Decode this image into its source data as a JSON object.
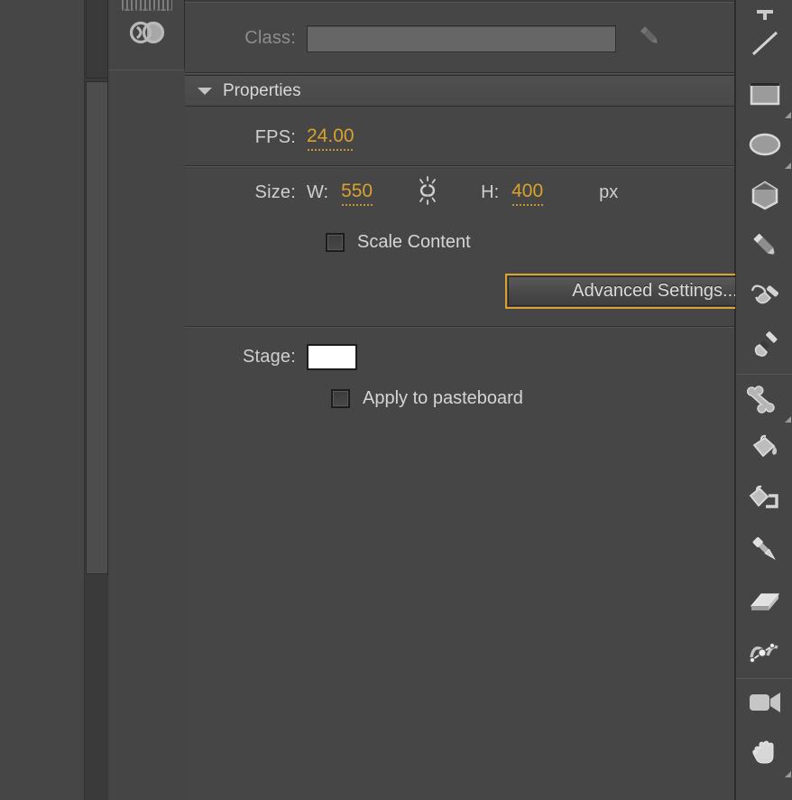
{
  "panel": {
    "class": {
      "label": "Class:",
      "value": "",
      "placeholder": "",
      "edit_icon": "pencil-icon"
    },
    "properties_section": {
      "title": "Properties",
      "disclosure": "triangle-down-icon",
      "expanded": true
    },
    "fps": {
      "label": "FPS:",
      "value": "24.00"
    },
    "size": {
      "label": "Size:",
      "w_label": "W:",
      "w_value": "550",
      "link_icon": "broken-link-icon",
      "link_state": "unlinked",
      "h_label": "H:",
      "h_value": "400",
      "unit": "px"
    },
    "scale_content": {
      "label": "Scale Content",
      "checked": false
    },
    "advanced_settings": {
      "label": "Advanced Settings...",
      "focused": true
    },
    "stage": {
      "label": "Stage:",
      "color": "#ffffff"
    },
    "apply_to_pasteboard": {
      "label": "Apply to pasteboard",
      "checked": false
    }
  },
  "dock": {
    "grip": "drag-grip-icon",
    "items": [
      {
        "icon": "creative-cloud-icon",
        "name": "creative-cloud-libraries"
      }
    ]
  },
  "tools": [
    {
      "name": "text-tool",
      "icon": "text-tool-icon",
      "clipped": true,
      "corner": false
    },
    {
      "name": "line-tool",
      "icon": "line-tool-icon",
      "clipped": false,
      "corner": false
    },
    {
      "name": "rectangle-tool",
      "icon": "rectangle-tool-icon",
      "clipped": false,
      "corner": true
    },
    {
      "name": "oval-tool",
      "icon": "oval-tool-icon",
      "clipped": false,
      "corner": true
    },
    {
      "name": "polystar-tool",
      "icon": "polystar-tool-icon",
      "clipped": false,
      "corner": false
    },
    {
      "name": "pencil-tool",
      "icon": "pencil-tool-icon",
      "clipped": false,
      "corner": false
    },
    {
      "name": "paint-brush-tool",
      "icon": "paint-brush-tool-icon",
      "clipped": false,
      "corner": false
    },
    {
      "name": "brush-tool",
      "icon": "brush-tool-icon",
      "clipped": false,
      "corner": false
    },
    {
      "name": "bone-tool",
      "icon": "bone-tool-icon",
      "clipped": false,
      "corner": true
    },
    {
      "name": "paint-bucket-tool",
      "icon": "paint-bucket-tool-icon",
      "clipped": false,
      "corner": false
    },
    {
      "name": "ink-bottle-tool",
      "icon": "ink-bottle-tool-icon",
      "clipped": false,
      "corner": false
    },
    {
      "name": "eyedropper-tool",
      "icon": "eyedropper-tool-icon",
      "clipped": false,
      "corner": false
    },
    {
      "name": "eraser-tool",
      "icon": "eraser-tool-icon",
      "clipped": false,
      "corner": false
    },
    {
      "name": "width-tool",
      "icon": "width-tool-icon",
      "clipped": false,
      "corner": false
    },
    {
      "name": "camera-tool",
      "icon": "camera-tool-icon",
      "clipped": false,
      "corner": false
    },
    {
      "name": "hand-tool",
      "icon": "hand-tool-icon",
      "clipped": false,
      "corner": true
    }
  ],
  "colors": {
    "panel_bg": "#464646",
    "accent_orange": "#D9A22E",
    "label_text": "#cfcfcf",
    "disabled_text": "#8d8d8d",
    "stage_color": "#ffffff"
  }
}
